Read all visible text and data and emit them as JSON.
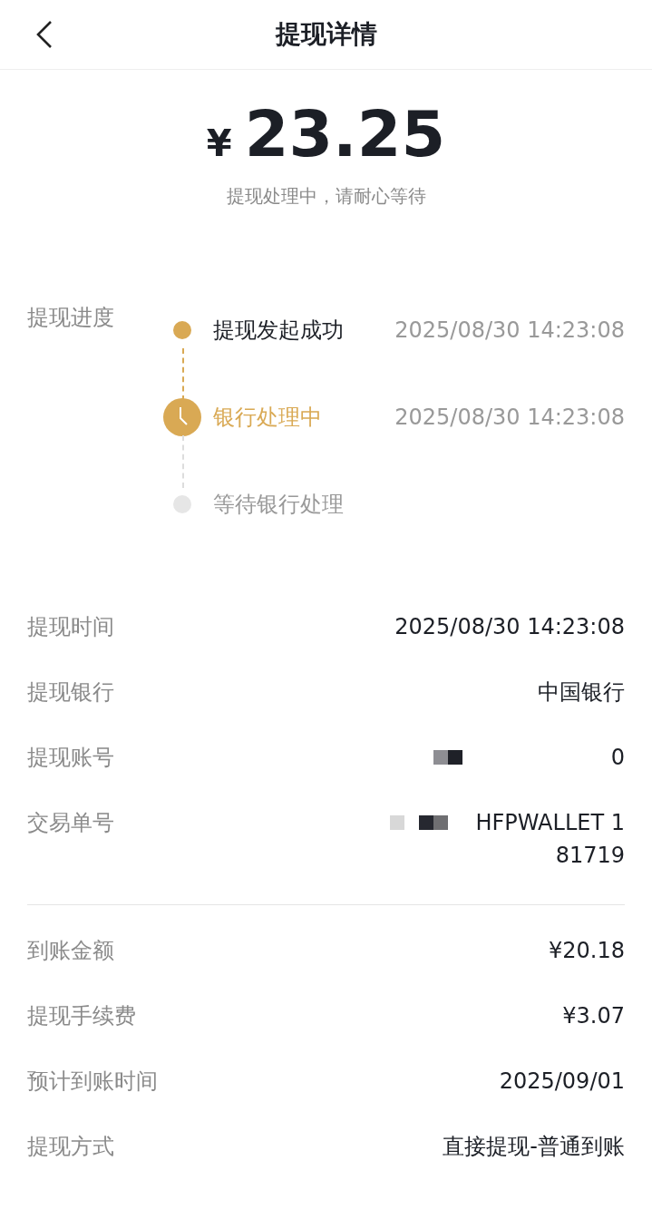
{
  "header": {
    "title": "提现详情"
  },
  "amount": {
    "currency": "¥",
    "value": "23.25",
    "note": "提现处理中，请耐心等待"
  },
  "progress": {
    "label": "提现进度",
    "steps": [
      {
        "title": "提现发起成功",
        "time": "2025/08/30 14:23:08",
        "kind": "done"
      },
      {
        "title": "银行处理中",
        "time": "2025/08/30 14:23:08",
        "kind": "current"
      },
      {
        "title": "等待银行处理",
        "kind": "pending"
      }
    ]
  },
  "details": [
    {
      "label": "提现时间",
      "value": [
        "2025/08/30 14:23:08"
      ]
    },
    {
      "label": "提现银行",
      "value": [
        "中国银行"
      ]
    },
    {
      "label": "提现账号",
      "value": [
        "0"
      ],
      "redacted": true
    },
    {
      "label": "交易单号",
      "value": [
        "HFPWALLET 1",
        "81719"
      ],
      "redacted": true
    }
  ],
  "amounts": [
    {
      "label": "到账金额",
      "value": "¥20.18"
    },
    {
      "label": "提现手续费",
      "value": "¥3.07"
    },
    {
      "label": "预计到账时间",
      "value": "2025/09/01"
    },
    {
      "label": "提现方式",
      "value": "直接提现-普通到账"
    }
  ]
}
